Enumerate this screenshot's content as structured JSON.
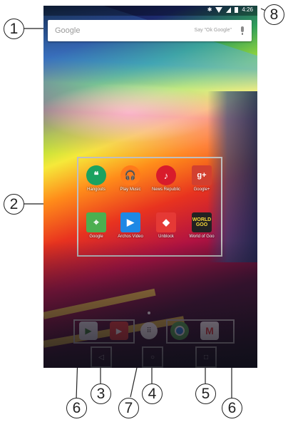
{
  "status_bar": {
    "time": "4:26",
    "icons": [
      "bluetooth-icon",
      "wifi-icon",
      "signal-icon",
      "battery-icon"
    ]
  },
  "search": {
    "logo": "Google",
    "voice_hint": "Say \"Ok Google\""
  },
  "apps": [
    {
      "label": "Hangouts",
      "icon": "hangouts-icon",
      "color": "#1aa260"
    },
    {
      "label": "Play Music",
      "icon": "play-music-icon",
      "color": "#ff7a1a"
    },
    {
      "label": "News Republic",
      "icon": "news-republic-icon",
      "color": "#d81b2b"
    },
    {
      "label": "Google+",
      "icon": "google-plus-icon",
      "color": "#d2402f"
    },
    {
      "label": "Google",
      "icon": "maps-icon",
      "color": "#4caf50"
    },
    {
      "label": "Archos Video",
      "icon": "archos-video-icon",
      "color": "#1e88e5"
    },
    {
      "label": "Unblock",
      "icon": "cubes-icon",
      "color": "#e53935"
    },
    {
      "label": "World of Goo",
      "icon": "world-of-goo-icon",
      "color": "#222222"
    }
  ],
  "dock": {
    "left_apps": [
      {
        "name": "play-store-icon",
        "color": "#dfe6e9"
      },
      {
        "name": "youtube-icon",
        "color": "#e53935"
      }
    ],
    "launcher": "apps-launcher-icon",
    "right_apps": [
      {
        "name": "chrome-icon",
        "color": "#4caf50"
      },
      {
        "name": "gmail-icon",
        "color": "#ffffff"
      }
    ]
  },
  "nav": {
    "back": "◁",
    "home": "○",
    "recents": "□"
  },
  "callouts": [
    "1",
    "2",
    "3",
    "4",
    "5",
    "6",
    "7",
    "6",
    "8"
  ]
}
